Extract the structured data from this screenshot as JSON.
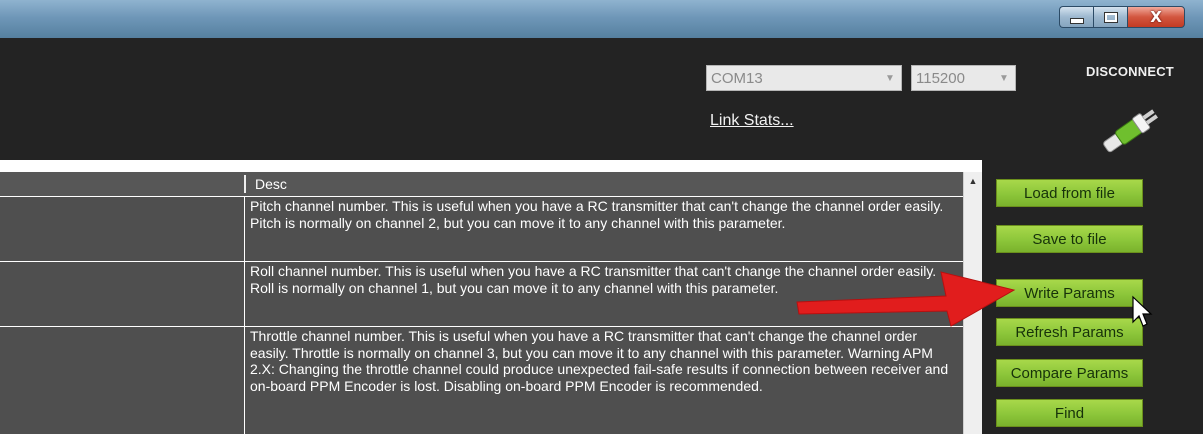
{
  "window": {
    "minimize_icon": "minimize-icon",
    "maximize_icon": "maximize-icon",
    "close_glyph": "X"
  },
  "connection": {
    "port_value": "COM13",
    "baud_value": "115200",
    "link_stats_label": "Link Stats...",
    "disconnect_label": "DISCONNECT",
    "plug_icon": "plug-icon"
  },
  "grid": {
    "column_headers": [
      "",
      "Desc"
    ],
    "rows": [
      {
        "name": "",
        "desc": "Pitch channel number. This is useful when you have a RC transmitter that can't change the channel order easily. Pitch is normally on channel 2, but you can move it to any channel with this parameter."
      },
      {
        "name": "",
        "desc": "Roll channel number. This is useful when you have a RC transmitter that can't change the channel order easily. Roll is normally on channel 1, but you can move it to any channel with this parameter."
      },
      {
        "name": "",
        "desc": "Throttle channel number. This is useful when you have a RC transmitter that can't change the channel order easily. Throttle is normally on channel 3, but you can move it to any channel with this parameter. Warning APM 2.X: Changing the throttle channel could produce unexpected fail-safe results if connection between receiver and on-board PPM Encoder is lost. Disabling on-board PPM Encoder is recommended."
      }
    ]
  },
  "actions": {
    "load_from_file": "Load from file",
    "save_to_file": "Save to file",
    "write_params": "Write Params",
    "refresh_params": "Refresh Params",
    "compare_params": "Compare Params",
    "find": "Find"
  },
  "colors": {
    "button_green": "#8cc63a",
    "annotation_arrow": "#e11d1d",
    "toolbar_bg": "#232323"
  }
}
